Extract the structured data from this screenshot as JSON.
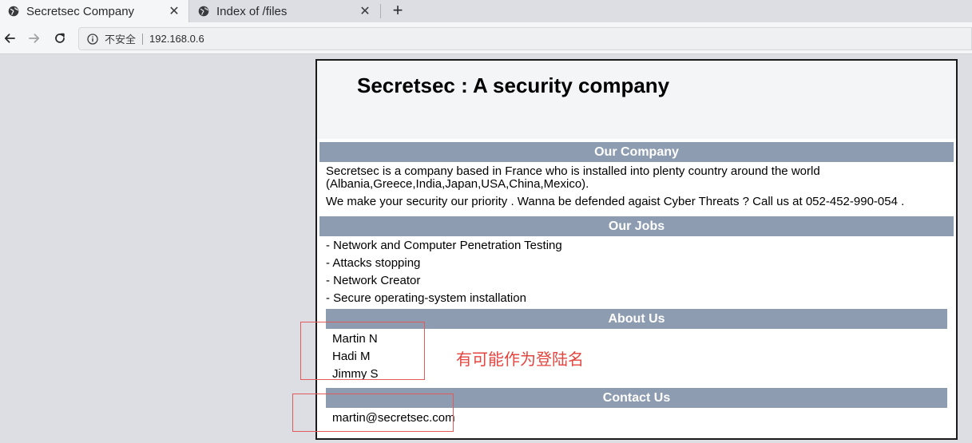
{
  "browser": {
    "tabs": [
      {
        "title": "Secretsec Company",
        "active": true,
        "favicon": "globe-icon"
      },
      {
        "title": "Index of /files",
        "active": false,
        "favicon": "globe-icon"
      }
    ],
    "close_glyph": "✕",
    "new_tab_glyph": "+",
    "url_bar": {
      "security_label": "不安全",
      "address": "192.168.0.6"
    }
  },
  "page": {
    "title": "Secretsec : A security company",
    "sections": {
      "company": {
        "heading": "Our Company",
        "lines": [
          "Secretsec is a company based in France who is installed into plenty country around the world",
          "(Albania,Greece,India,Japan,USA,China,Mexico).",
          "We make your security our priority . Wanna be defended agaist Cyber Threats ? Call us at 052-452-990-054 ."
        ]
      },
      "jobs": {
        "heading": "Our Jobs",
        "items": [
          "- Network and Computer Penetration Testing",
          "- Attacks stopping",
          "- Network Creator",
          "- Secure operating-system installation"
        ]
      },
      "about": {
        "heading": "About Us",
        "members": [
          "Martin N",
          "Hadi M",
          "Jimmy S"
        ]
      },
      "contact": {
        "heading": "Contact Us",
        "email": "martin@secretsec.com"
      }
    }
  },
  "annotation": {
    "note": "有可能作为登陆名",
    "color": "#e5443f"
  },
  "colors": {
    "section_bar": "#8e9cb1",
    "header_bg": "#f4f5f7",
    "chrome_bg": "#dcdee3"
  }
}
